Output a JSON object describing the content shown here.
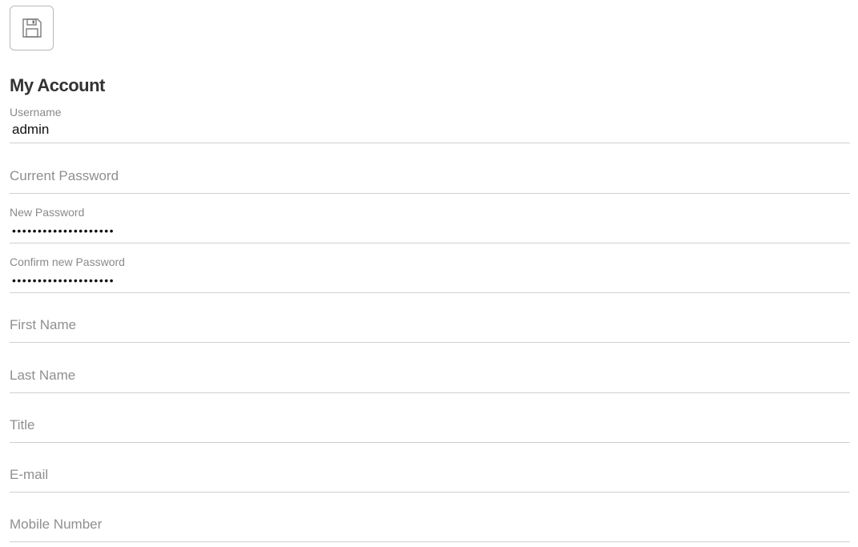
{
  "toolbar": {
    "save_icon": "floppy-disk-icon"
  },
  "page": {
    "title": "My Account"
  },
  "form": {
    "username": {
      "label": "Username",
      "value": "admin"
    },
    "current_password": {
      "placeholder": "Current Password"
    },
    "new_password": {
      "label": "New Password",
      "masked_value": "••••••••••••••••••••"
    },
    "confirm_password": {
      "label": "Confirm new Password",
      "masked_value": "••••••••••••••••••••"
    },
    "first_name": {
      "placeholder": "First Name"
    },
    "last_name": {
      "placeholder": "Last Name"
    },
    "title": {
      "placeholder": "Title"
    },
    "email": {
      "placeholder": "E-mail"
    },
    "mobile": {
      "placeholder": "Mobile Number"
    }
  }
}
